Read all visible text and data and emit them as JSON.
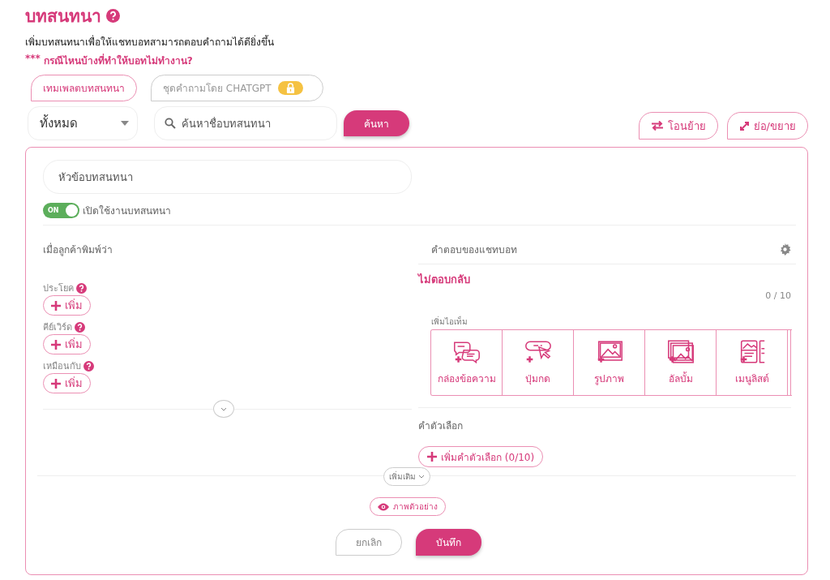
{
  "page": {
    "title": "บทสนทนา",
    "description": "เพิ่มบทสนทนาเพื่อให้แชทบอทสามารถตอบคำถามได้ดียิ่งขึ้น",
    "warning_marks": "***",
    "warning_link": "กรณีไหนบ้างที่ทำให้บอทไม่ทำงาน?"
  },
  "tabs": [
    {
      "label": "เทมเพลตบทสนทนา",
      "selected": true,
      "locked": false
    },
    {
      "label": "ชุดคำถามโดย CHATGPT",
      "selected": false,
      "locked": true
    }
  ],
  "filter": {
    "value": "ทั้งหมด"
  },
  "search": {
    "placeholder": "ค้นหาชื่อบทสนทนา",
    "button": "ค้นหา"
  },
  "actions": [
    {
      "label": "โอนย้าย",
      "kind": "transfer"
    },
    {
      "label": "ย่อ/ขยาย",
      "kind": "expand"
    }
  ],
  "editor": {
    "topic": {
      "placeholder": "หัวข้อบทสนทนา"
    },
    "toggle": {
      "on": true,
      "text": "ON",
      "label": "เปิดใช้งานบทสนทนา"
    },
    "triggers": {
      "heading": "เมื่อลูกค้าพิมพ์ว่า",
      "groups": [
        {
          "label": "ประโยค",
          "button": "เพิ่ม"
        },
        {
          "label": "คีย์เวิร์ด",
          "button": "เพิ่ม"
        },
        {
          "label": "เหมือนกับ",
          "button": "เพิ่ม"
        }
      ]
    },
    "responses": {
      "heading": "คำตอบของแชทบอท",
      "status": "ไม่ตอบกลับ",
      "count": "0 / 10",
      "items_label": "เพิ่มไอเท็ม",
      "items": [
        {
          "label": "กล่องข้อความ",
          "kind": "text"
        },
        {
          "label": "ปุ่มกด",
          "kind": "button"
        },
        {
          "label": "รูปภาพ",
          "kind": "image"
        },
        {
          "label": "อัลบั้ม",
          "kind": "album"
        },
        {
          "label": "เมนูลิสต์",
          "kind": "menu"
        }
      ],
      "options_heading": "คำตัวเลือก",
      "add_option": "เพิ่มคำตัวเลือก (0/10)"
    },
    "more": "เพิ่มเติม",
    "preview": "ภาพตัวอย่าง",
    "cancel": "ยกเลิก",
    "save": "บันทึก"
  }
}
